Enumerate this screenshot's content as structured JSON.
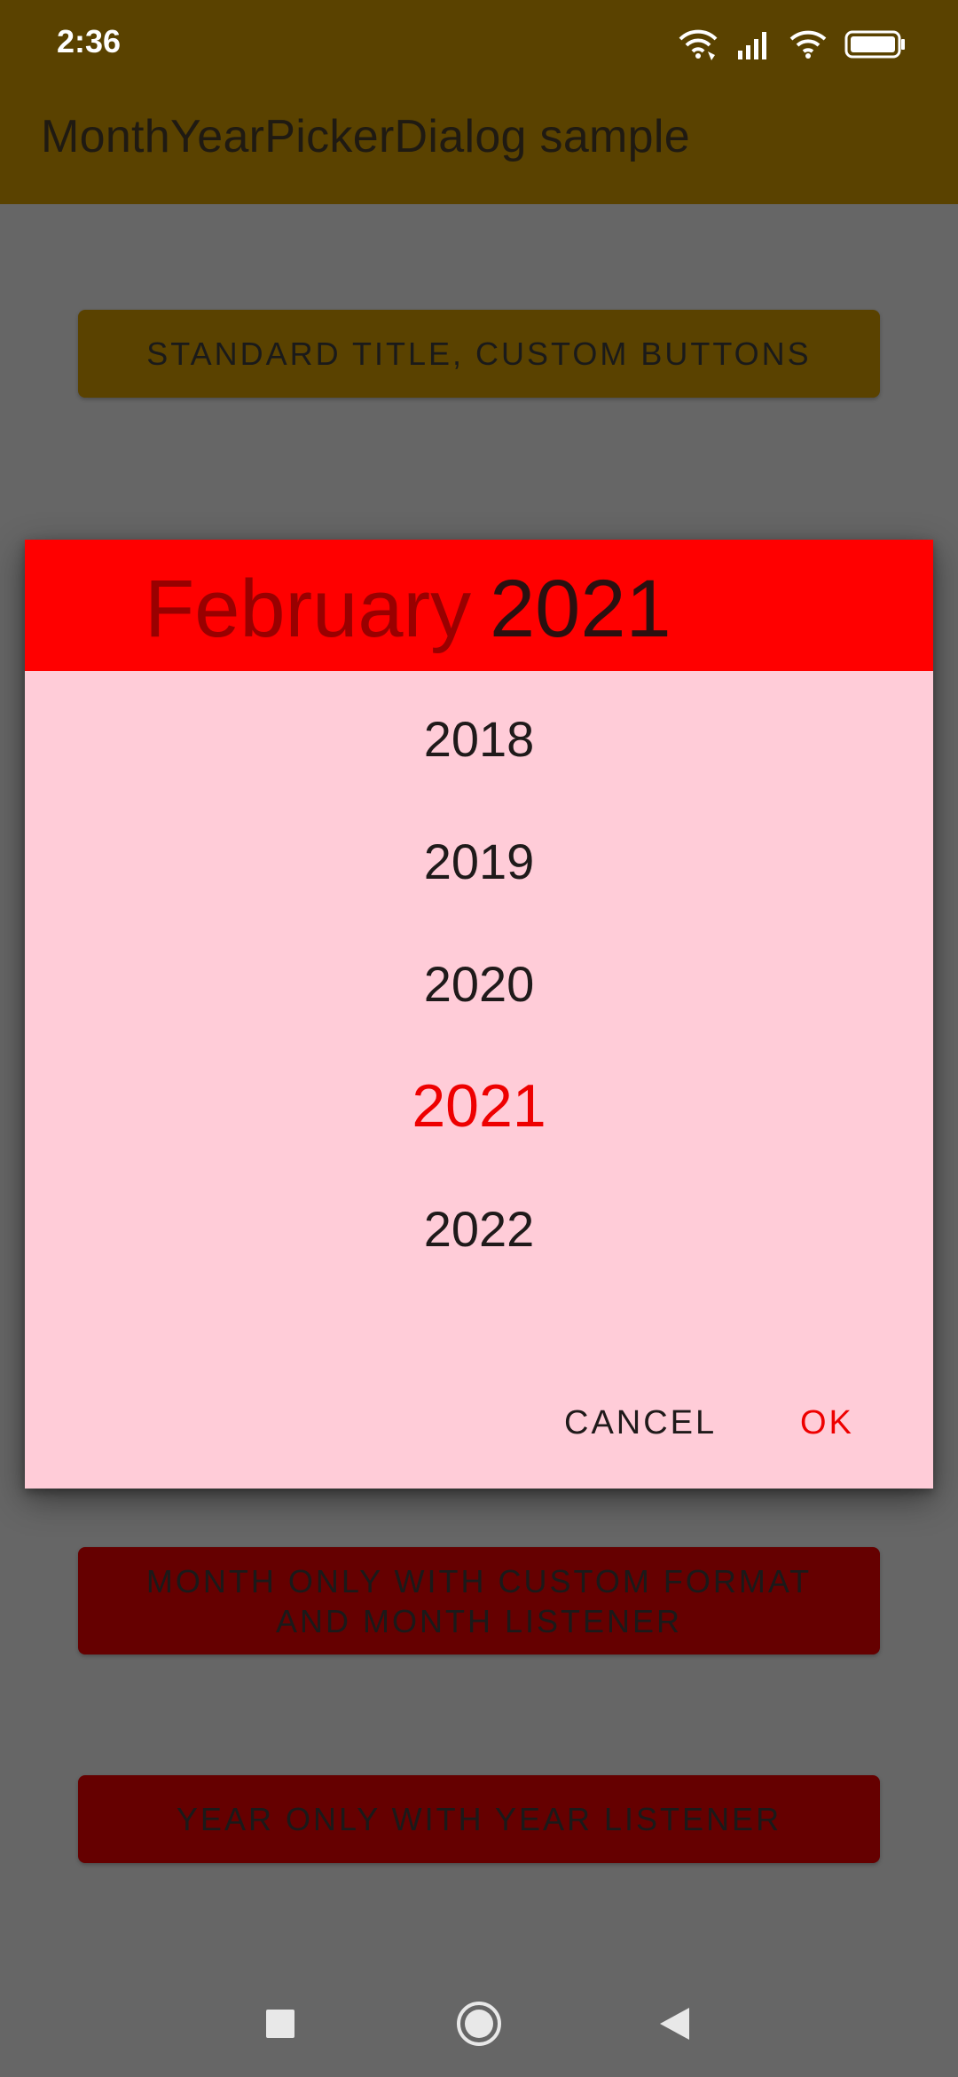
{
  "status_bar": {
    "time": "2:36",
    "icons": [
      "wifi-calling-icon",
      "signal-icon",
      "wifi-icon",
      "battery-icon"
    ]
  },
  "app_bar": {
    "title": "MonthYearPickerDialog sample"
  },
  "buttons": {
    "standard": "Standard title, custom buttons",
    "month_only_line1": "Month only with custom format",
    "month_only_line2": "and month listener",
    "year_only": "Year only with year listener"
  },
  "dialog": {
    "header_month": "February",
    "header_year": "2021",
    "years": [
      "2018",
      "2019",
      "2020",
      "2021",
      "2022"
    ],
    "selected_year": "2021",
    "cancel_label": "CANCEL",
    "ok_label": "OK",
    "colors": {
      "header": "#ff0000",
      "body": "#ffccd8",
      "accent": "#ee0000"
    }
  },
  "nav_bar": {
    "icons": [
      "recents-icon",
      "home-icon",
      "back-icon"
    ]
  }
}
